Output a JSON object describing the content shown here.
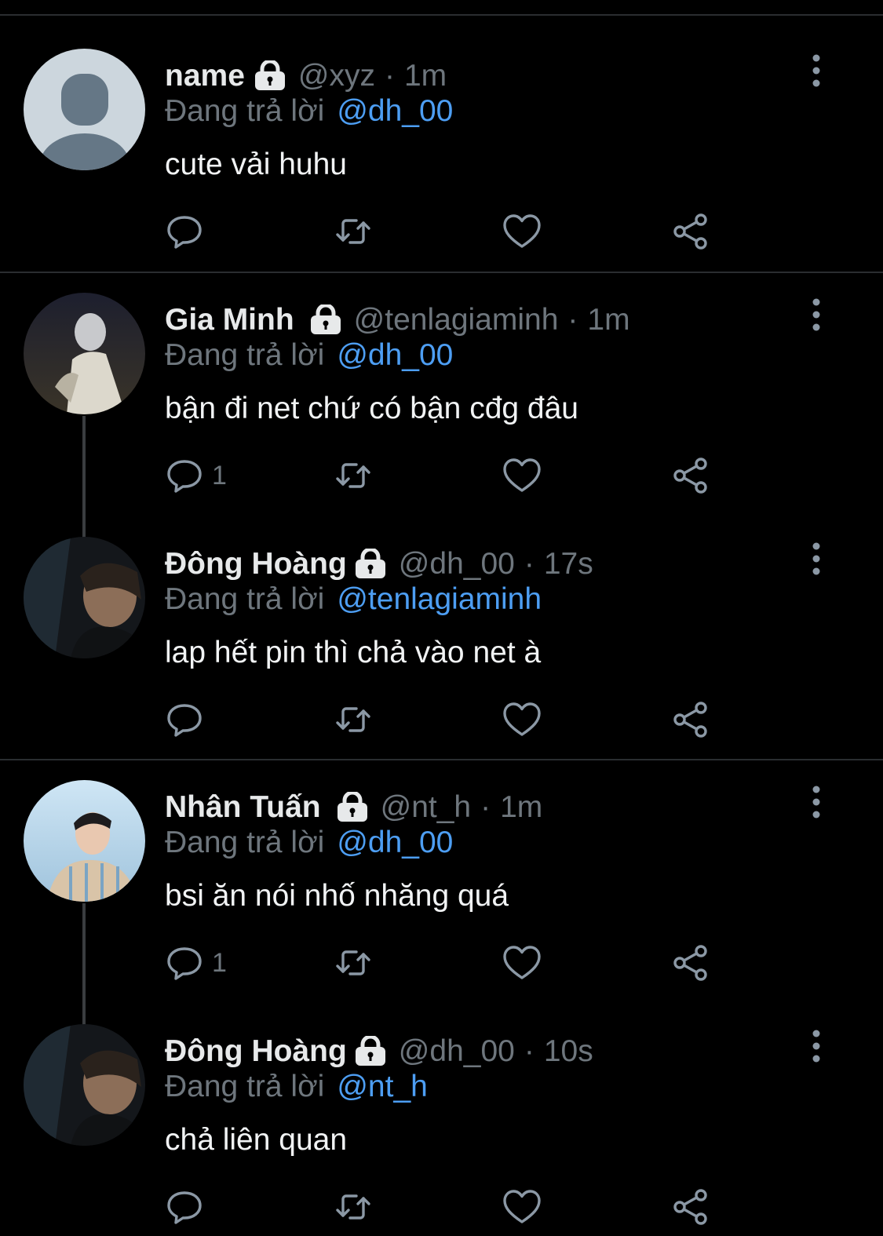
{
  "colors": {
    "background": "#000000",
    "text": "#e7e9ea",
    "muted": "#6e767d",
    "link": "#4d9ef3",
    "divider": "#2a2d30"
  },
  "icons": {
    "lock": "lock-icon",
    "more": "more-vertical-icon",
    "reply": "reply-icon",
    "retweet": "retweet-icon",
    "like": "heart-icon",
    "share": "share-icon"
  },
  "tweets": [
    {
      "name": "name",
      "handle": "@xyz",
      "dot": "·",
      "time": "1m",
      "reply_prefix": "Đang trả lời",
      "reply_to": "@dh_00",
      "text": "cute vải huhu",
      "reply_count": ""
    },
    {
      "name": "Gia Minh",
      "handle": "@tenlagiaminh",
      "dot": "·",
      "time": "1m",
      "reply_prefix": "Đang trả lời",
      "reply_to": "@dh_00",
      "text": "bận đi net chứ có bận cđg đâu",
      "reply_count": "1"
    },
    {
      "name": "Đông Hoàng",
      "handle": "@dh_00",
      "dot": "·",
      "time": "17s",
      "reply_prefix": "Đang trả lời",
      "reply_to": "@tenlagiaminh",
      "text": "lap hết pin thì chả vào net à",
      "reply_count": ""
    },
    {
      "name": "Nhân Tuấn",
      "handle": "@nt_h",
      "dot": "·",
      "time": "1m",
      "reply_prefix": "Đang trả lời",
      "reply_to": "@dh_00",
      "text": "bsi ăn nói nhố nhăng quá",
      "reply_count": "1"
    },
    {
      "name": "Đông Hoàng",
      "handle": "@dh_00",
      "dot": "·",
      "time": "10s",
      "reply_prefix": "Đang trả lời",
      "reply_to": "@nt_h",
      "text": "chả liên quan",
      "reply_count": ""
    }
  ]
}
